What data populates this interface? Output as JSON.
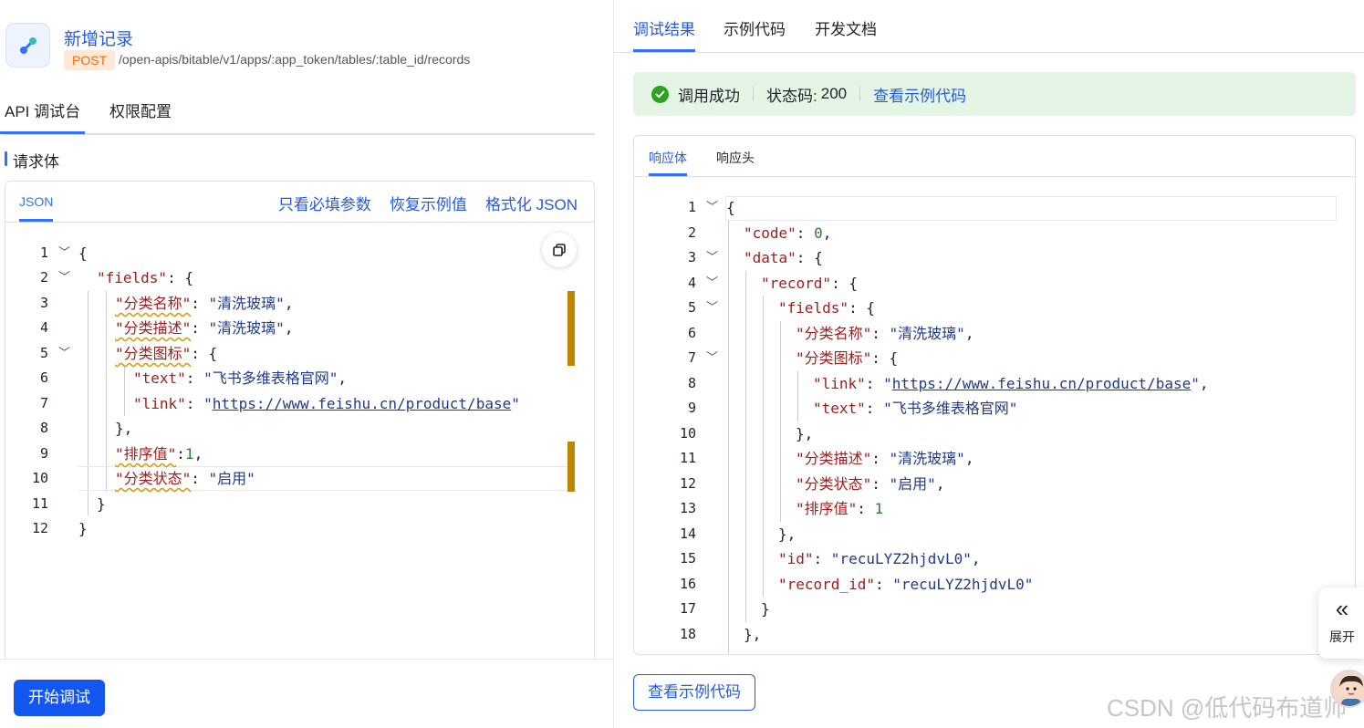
{
  "api": {
    "title": "新增记录",
    "method": "POST",
    "path": "/open-apis/bitable/v1/apps/:app_token/tables/:table_id/records"
  },
  "left_tabs": [
    "API 调试台",
    "权限配置"
  ],
  "request": {
    "section_title": "请求体",
    "format_tab": "JSON",
    "actions": [
      "只看必填参数",
      "恢复示例值",
      "格式化 JSON"
    ]
  },
  "request_lines": [
    "1",
    "2",
    "3",
    "4",
    "5",
    "6",
    "7",
    "8",
    "9",
    "10",
    "11",
    "12"
  ],
  "request_code": {
    "l1": "{",
    "l2_key": "\"fields\"",
    "l2_rest": ": {",
    "l3_key": "\"分类名称\"",
    "l3_val": "\"清洗玻璃\"",
    "l4_key": "\"分类描述\"",
    "l4_val": "\"清洗玻璃\"",
    "l5_key": "\"分类图标\"",
    "l5_rest": ": {",
    "l6_key": "\"text\"",
    "l6_val": "\"飞书多维表格官网\"",
    "l7_key": "\"link\"",
    "l7_val": "https://www.feishu.cn/product/base",
    "l8": "},",
    "l9_key": "\"排序值\"",
    "l9_val": "1",
    "l10_key": "\"分类状态\"",
    "l10_val": "\"启用\"",
    "l11": "}",
    "l12": "}"
  },
  "start_button": "开始调试",
  "right_tabs": [
    "调试结果",
    "示例代码",
    "开发文档"
  ],
  "status": {
    "message": "调用成功",
    "code_label": "状态码:",
    "code_value": "200",
    "link": "查看示例代码"
  },
  "response_tabs": [
    "响应体",
    "响应头"
  ],
  "response_lines": [
    "1",
    "2",
    "3",
    "4",
    "5",
    "6",
    "7",
    "8",
    "9",
    "10",
    "11",
    "12",
    "13",
    "14",
    "15",
    "16",
    "17",
    "18"
  ],
  "response_code": {
    "l1": "{",
    "l2_key": "\"code\"",
    "l2_val": "0",
    "l3_key": "\"data\"",
    "l4_key": "\"record\"",
    "l5_key": "\"fields\"",
    "l6_key": "\"分类名称\"",
    "l6_val": "\"清洗玻璃\"",
    "l7_key": "\"分类图标\"",
    "l8_key": "\"link\"",
    "l8_val": "https://www.feishu.cn/product/base",
    "l9_key": "\"text\"",
    "l9_val": "\"飞书多维表格官网\"",
    "l10": "},",
    "l11_key": "\"分类描述\"",
    "l11_val": "\"清洗玻璃\"",
    "l12_key": "\"分类状态\"",
    "l12_val": "\"启用\"",
    "l13_key": "\"排序值\"",
    "l13_val": "1",
    "l14": "},",
    "l15_key": "\"id\"",
    "l15_val": "\"recuLYZ2hjdvL0\"",
    "l16_key": "\"record_id\"",
    "l16_val": "\"recuLYZ2hjdvL0\"",
    "l17": "}",
    "l18": "},"
  },
  "view_code_button": "查看示例代码",
  "expand": {
    "icon": "double-chevron-left-icon",
    "label": "展开"
  },
  "watermark": "CSDN @低代码布道师",
  "colors": {
    "accent": "#3370ff",
    "success": "#2ea121",
    "method": "#ed6d0c",
    "primary_button": "#1456f0"
  }
}
